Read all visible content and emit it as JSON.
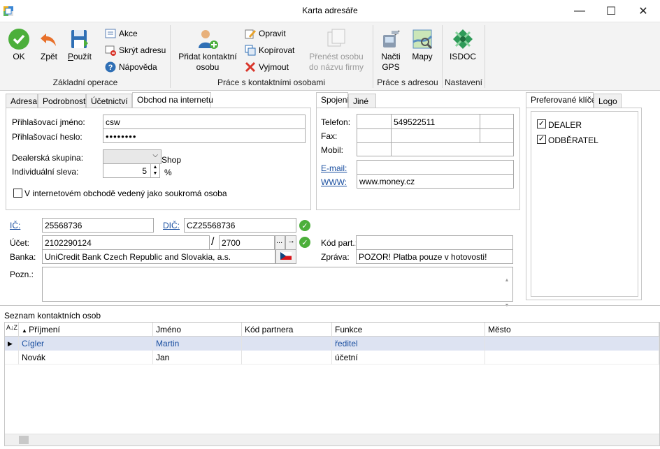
{
  "window": {
    "title": "Karta adresáře",
    "minimize": "—",
    "maximize": "☐",
    "close": "✕"
  },
  "ribbon": {
    "ok": "OK",
    "back": "Zpět",
    "use": "Použít",
    "akce": "Akce",
    "hide_address": "Skrýt adresu",
    "help": "Nápověda",
    "group_basic": "Základní operace",
    "add_contact_1": "Přidat kontaktní",
    "add_contact_2": "osobu",
    "edit": "Opravit",
    "copy": "Kopírovat",
    "remove": "Vyjmout",
    "transfer_1": "Přenést osobu",
    "transfer_2": "do názvu firmy",
    "group_contacts": "Práce s kontaktními osobami",
    "load_gps_1": "Načti",
    "load_gps_2": "GPS",
    "maps": "Mapy",
    "group_address": "Práce s adresou",
    "isdoc": "ISDOC",
    "group_settings": "Nastavení"
  },
  "left_tabs": [
    "Adresa",
    "Podrobnosti",
    "Účetnictví",
    "Obchod na internetu"
  ],
  "eshop": {
    "login_label": "Přihlašovací jméno:",
    "login_value": "csw",
    "password_label": "Přihlašovací heslo:",
    "password_value": "••••••••",
    "dealer_group_label": "Dealerská skupina:",
    "dealer_group_value": "",
    "dealer_group_suffix": "Shop",
    "discount_label": "Individuální sleva:",
    "discount_value": "5",
    "discount_unit": "%",
    "private_label": "V internetovém obchodě vedený jako soukromá osoba",
    "private_checked": false
  },
  "right_tabs": [
    "Spojení",
    "Jiné"
  ],
  "contact": {
    "phone_label": "Telefon:",
    "phone_value": "549522511",
    "fax_label": "Fax:",
    "mobile_label": "Mobil:",
    "email_label": "E-mail:",
    "email_value": "",
    "www_label": "WWW:",
    "www_value": "www.money.cz"
  },
  "keys_tabs": [
    "Preferované klíče",
    "Logo"
  ],
  "keys": [
    {
      "label": "DEALER",
      "checked": true
    },
    {
      "label": "ODBĚRATEL",
      "checked": true
    }
  ],
  "ids": {
    "ic_label": "IČ:",
    "ic_value": "25568736",
    "dic_label": "DIČ:",
    "dic_value": "CZ25568736",
    "account_label": "Účet:",
    "account_value": "2102290124",
    "slash": "/",
    "bank_code": "2700",
    "ellipsis_btn": "...",
    "arrow_btn": "→",
    "bank_label": "Banka:",
    "bank_value": "UniCredit Bank Czech Republic and Slovakia, a.s.",
    "partner_code_label": "Kód part.:",
    "partner_code_value": "",
    "message_label": "Zpráva:",
    "message_value": "POZOR! Platba pouze v hotovosti!",
    "note_label": "Pozn.:",
    "note_value": ""
  },
  "contacts_list": {
    "title": "Seznam kontaktních osob",
    "columns": [
      "Příjmení",
      "Jméno",
      "Kód partnera",
      "Funkce",
      "Město"
    ],
    "rows": [
      [
        "Cígler",
        "Martin",
        "",
        "ředitel",
        ""
      ],
      [
        "Novák",
        "Jan",
        "",
        "účetní",
        ""
      ]
    ]
  },
  "colors": {
    "accent": "#1a4fa0",
    "selected_row": "#dde3f2",
    "ok_green": "#4caf3b"
  }
}
